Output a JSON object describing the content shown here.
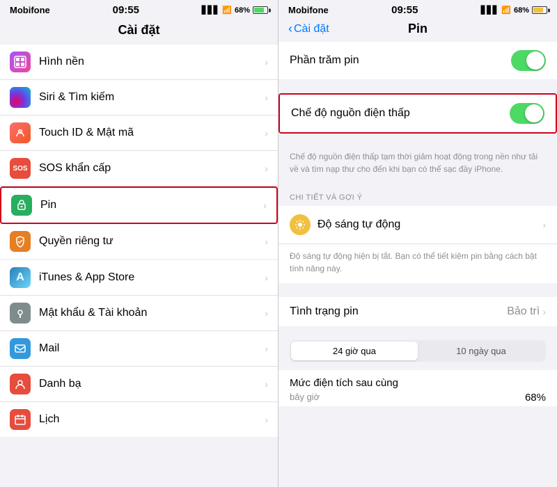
{
  "left": {
    "carrier": "Mobifone",
    "time": "09:55",
    "battery_pct": "68%",
    "title": "Cài đặt",
    "items": [
      {
        "id": "hinh-nen",
        "label": "Hình nền",
        "icon_class": "icon-hinh-nen",
        "icon_char": "🖼",
        "highlighted": false
      },
      {
        "id": "siri",
        "label": "Siri & Tìm kiếm",
        "icon_class": "icon-siri",
        "icon_char": "",
        "highlighted": false
      },
      {
        "id": "touch-id",
        "label": "Touch ID & Mật mã",
        "icon_class": "icon-touch",
        "icon_char": "👆",
        "highlighted": false
      },
      {
        "id": "sos",
        "label": "SOS khẩn cấp",
        "icon_class": "icon-sos",
        "icon_char": "SOS",
        "highlighted": false
      },
      {
        "id": "pin",
        "label": "Pin",
        "icon_class": "icon-pin",
        "icon_char": "🔋",
        "highlighted": true
      },
      {
        "id": "quyen",
        "label": "Quyền riêng tư",
        "icon_class": "icon-quyen",
        "icon_char": "✋",
        "highlighted": false
      },
      {
        "id": "itunes",
        "label": "iTunes & App Store",
        "icon_class": "icon-itunes",
        "icon_char": "A",
        "highlighted": false
      },
      {
        "id": "mat-khau",
        "label": "Mật khẩu & Tài khoản",
        "icon_class": "icon-mat-khau",
        "icon_char": "🔑",
        "highlighted": false
      },
      {
        "id": "mail",
        "label": "Mail",
        "icon_class": "icon-mail",
        "icon_char": "✉",
        "highlighted": false
      },
      {
        "id": "danh-ba",
        "label": "Danh bạ",
        "icon_class": "icon-danh-ba",
        "icon_char": "👤",
        "highlighted": false
      },
      {
        "id": "lich",
        "label": "Lịch",
        "icon_class": "icon-lich",
        "icon_char": "📅",
        "highlighted": false
      }
    ]
  },
  "right": {
    "carrier": "Mobifone",
    "time": "09:55",
    "battery_pct": "68%",
    "back_label": "Cài đặt",
    "title": "Pin",
    "phan_tram_pin_label": "Phần trăm pin",
    "che_do_label": "Chế độ nguồn điện thấp",
    "che_do_description": "Chế độ nguồn điện thấp tạm thời giảm hoạt động trong nền như tải về và tìm nạp thư cho đến khi bạn có thể sạc đầy iPhone.",
    "section_chi_tiet": "CHI TIẾT VÀ GỢI Ý",
    "do_sang_label": "Độ sáng tự động",
    "do_sang_sub": "Độ sáng tự động hiện bị tắt. Bạn có thể tiết kiệm pin bằng cách bật tính năng này.",
    "tinh_trang_label": "Tình trạng pin",
    "tinh_trang_value": "Bảo trì",
    "tab_24h": "24 giờ qua",
    "tab_10d": "10 ngày qua",
    "muc_dien_label": "Mức điện tích sau cùng",
    "bay_gio": "bây giờ",
    "muc_dien_pct": "68%"
  }
}
